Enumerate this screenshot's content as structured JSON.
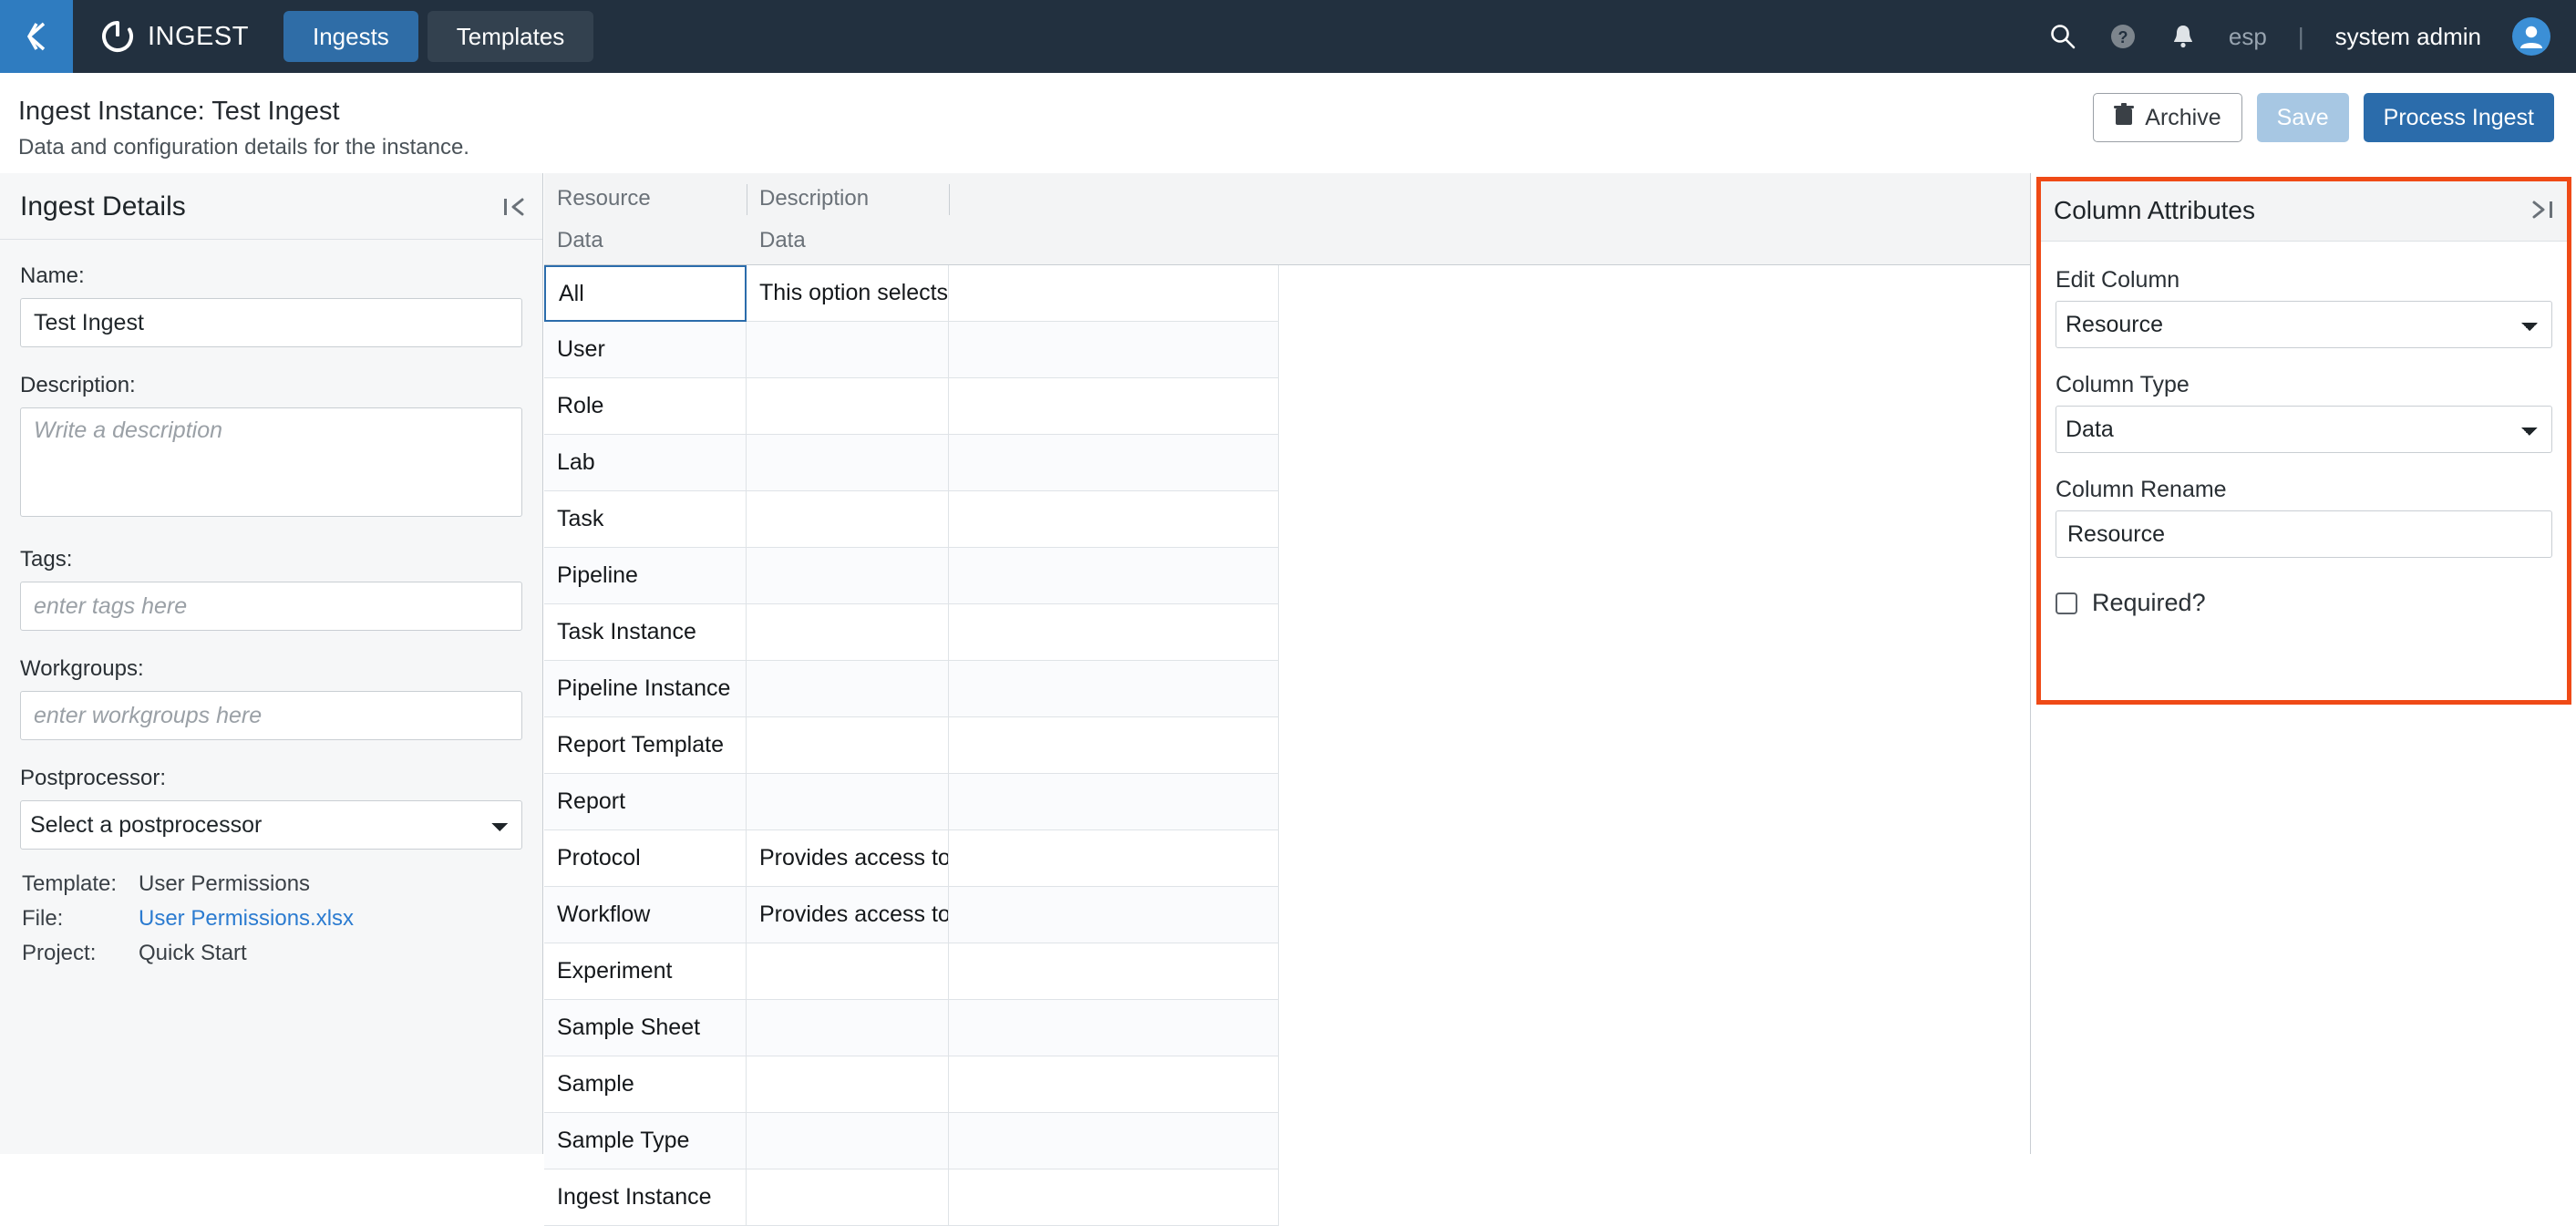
{
  "topnav": {
    "back_icon": "chevron-left-icon",
    "brand": "INGEST",
    "brand_logo_icon": "ingest-ring-logo-icon",
    "tabs": [
      {
        "label": "Ingests",
        "active": true
      },
      {
        "label": "Templates",
        "active": false
      }
    ],
    "search_icon": "search-icon",
    "help_icon": "help-circle-icon",
    "notification_icon": "bell-icon",
    "tenant": "esp",
    "separator": "|",
    "user": "system admin",
    "avatar_icon": "user-avatar-icon",
    "accent": "#2f7cc0",
    "background": "#22303f"
  },
  "pagehead": {
    "title": "Ingest Instance: Test Ingest",
    "subtitle": "Data and configuration details for the instance.",
    "archive_label": "Archive",
    "archive_icon": "trash-icon",
    "save_label": "Save",
    "process_label": "Process Ingest",
    "process_color": "#2b6cab",
    "save_color": "#a7c7e3"
  },
  "sidebar": {
    "title": "Ingest Details",
    "collapse_icon": "collapse-left-icon",
    "name_label": "Name:",
    "name_value": "Test Ingest",
    "description_label": "Description:",
    "description_value": "",
    "description_placeholder": "Write a description",
    "tags_label": "Tags:",
    "tags_value": "",
    "tags_placeholder": "enter tags here",
    "workgroups_label": "Workgroups:",
    "workgroups_value": "",
    "workgroups_placeholder": "enter workgroups here",
    "postprocessor_label": "Postprocessor:",
    "postprocessor_value": "Select a postprocessor",
    "meta": [
      {
        "key": "Template:",
        "value": "User Permissions",
        "link": false
      },
      {
        "key": "File:",
        "value": "User Permissions.xlsx",
        "link": true
      },
      {
        "key": "Project:",
        "value": "Quick Start",
        "link": false
      }
    ]
  },
  "table": {
    "columns": [
      {
        "name": "Resource",
        "type": "Data"
      },
      {
        "name": "Description",
        "type": "Data"
      },
      {
        "name": "",
        "type": ""
      }
    ],
    "rows": [
      {
        "resource": "All",
        "description": "This option selects all of the ...",
        "selected": true
      },
      {
        "resource": "User",
        "description": "",
        "selected": false
      },
      {
        "resource": "Role",
        "description": "",
        "selected": false
      },
      {
        "resource": "Lab",
        "description": "",
        "selected": false
      },
      {
        "resource": "Task",
        "description": "",
        "selected": false
      },
      {
        "resource": "Pipeline",
        "description": "",
        "selected": false
      },
      {
        "resource": "Task Instance",
        "description": "",
        "selected": false
      },
      {
        "resource": "Pipeline Instance",
        "description": "",
        "selected": false
      },
      {
        "resource": "Report Template",
        "description": "",
        "selected": false
      },
      {
        "resource": "Report",
        "description": "",
        "selected": false
      },
      {
        "resource": "Protocol",
        "description": "Provides access to the Proto...",
        "selected": false
      },
      {
        "resource": "Workflow",
        "description": "Provides access to the Workf...",
        "selected": false
      },
      {
        "resource": "Experiment",
        "description": "",
        "selected": false
      },
      {
        "resource": "Sample Sheet",
        "description": "",
        "selected": false
      },
      {
        "resource": "Sample",
        "description": "",
        "selected": false
      },
      {
        "resource": "Sample Type",
        "description": "",
        "selected": false
      },
      {
        "resource": "Ingest Instance",
        "description": "",
        "selected": false
      }
    ]
  },
  "column_attributes": {
    "title": "Column Attributes",
    "collapse_icon": "collapse-right-icon",
    "highlight_color": "#ef4a16",
    "edit_column_label": "Edit Column",
    "edit_column_value": "Resource",
    "column_type_label": "Column Type",
    "column_type_value": "Data",
    "column_rename_label": "Column Rename",
    "column_rename_value": "Resource",
    "required_label": "Required?",
    "required_checked": false
  }
}
